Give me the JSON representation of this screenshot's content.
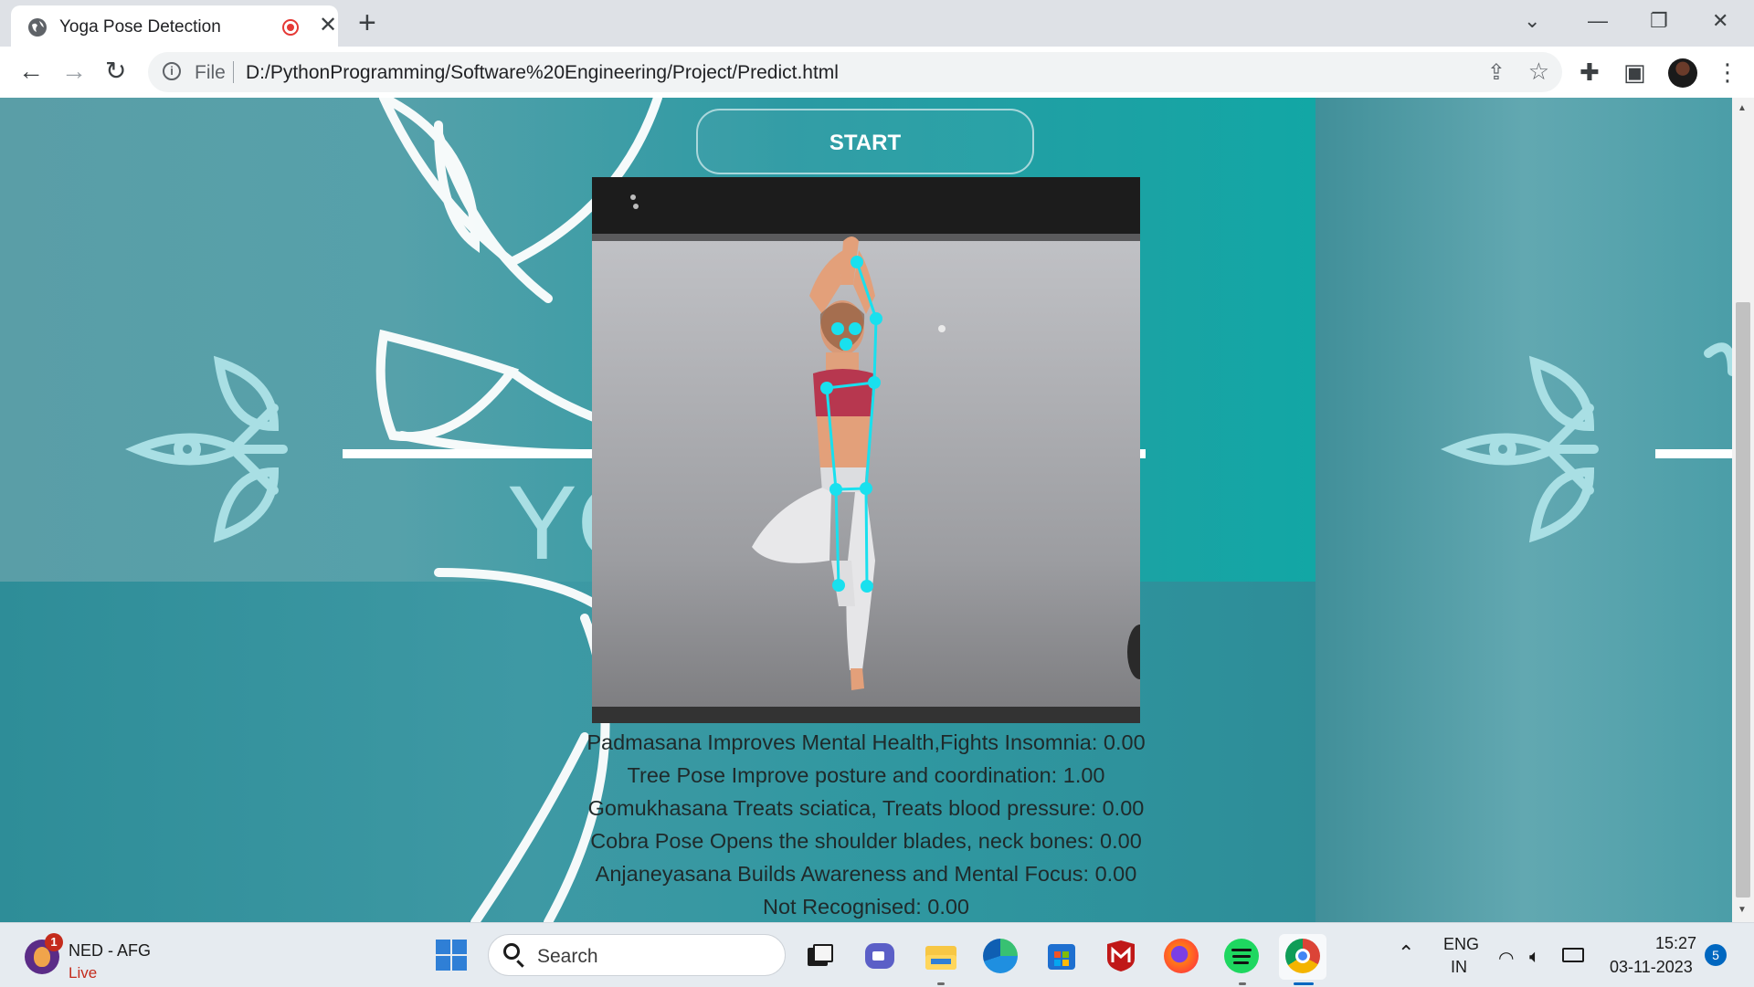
{
  "browser": {
    "tab_title": "Yoga Pose Detection",
    "tab_close": "✕",
    "new_tab": "+",
    "address_scheme": "File",
    "address_url": "D:/PythonProgramming/Software%20Engineering/Project/Predict.html"
  },
  "page": {
    "start_label": "START",
    "predictions": [
      "Padmasana Improves Mental Health,Fights Insomnia: 0.00",
      "Tree Pose Improve posture and coordination: 1.00",
      "Gomukhasana Treats sciatica, Treats blood pressure: 0.00",
      "Cobra Pose Opens the shoulder blades, neck bones: 0.00",
      "Anjaneyasana Builds Awareness and Mental Focus: 0.00",
      "Not Recognised: 0.00"
    ],
    "background_logo_text": "YO",
    "skeleton_color": "#19e0ee"
  },
  "taskbar": {
    "widget_badge": "1",
    "widget_title": "NED - AFG",
    "widget_status": "Live",
    "search_placeholder": "Search",
    "language_line1": "ENG",
    "language_line2": "IN",
    "time": "15:27",
    "date": "03-11-2023",
    "notification_count": "5",
    "apps": [
      "task-view-icon",
      "chat-icon",
      "file-explorer-icon",
      "edge-icon",
      "store-icon",
      "mcafee-icon",
      "firefox-icon",
      "spotify-icon",
      "chrome-icon"
    ]
  }
}
